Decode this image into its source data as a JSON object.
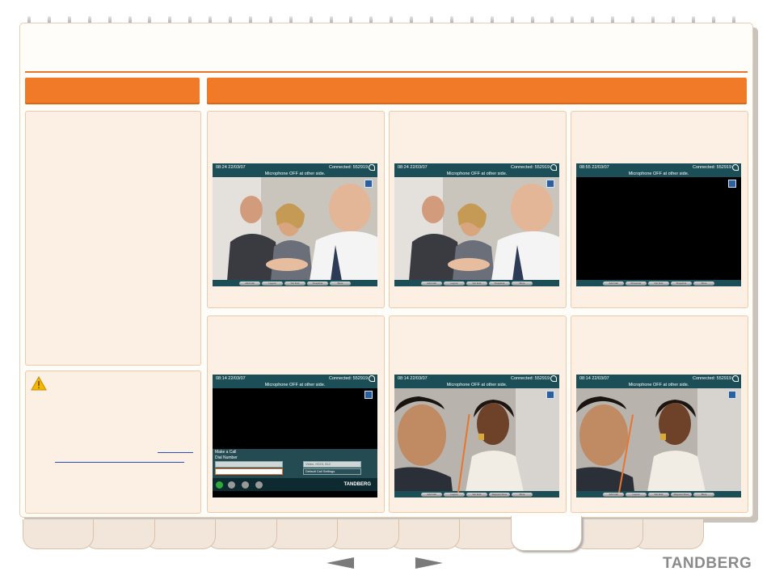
{
  "screens": {
    "top": [
      {
        "time": "08:24  22/03/07",
        "connected": "Connected: 552919",
        "message": "Microphone OFF at other side.",
        "buttons": [
          "Add Call",
          "Layout",
          "Far End",
          "Snapshot",
          "More"
        ]
      },
      {
        "time": "08:24  22/03/07",
        "connected": "Connected: 552919",
        "message": "Microphone OFF at other side.",
        "buttons": [
          "Add Call",
          "Layout",
          "Far End",
          "Snapshot",
          "More"
        ]
      },
      {
        "time": "08:55  22/03/07",
        "connected": "Connected: 552919",
        "message": "Microphone OFF at other side.",
        "buttons": [
          "Add Call",
          "Presenter",
          "Far End",
          "Snapshot",
          "More"
        ]
      }
    ],
    "bottom": [
      {
        "time": "08:14  22/03/07",
        "connected": "Connected: 552919",
        "message": "Microphone OFF at other side."
      },
      {
        "time": "08:14  22/03/07",
        "connected": "Connected: 552919",
        "message": "Microphone OFF at other side.",
        "buttons": [
          "Add Call",
          "Layout",
          "Far End",
          "Request Floor",
          "More"
        ]
      },
      {
        "time": "08:14  22/03/07",
        "connected": "Connected: 552919",
        "message": "Microphone OFF at other side.",
        "buttons": [
          "Add Call",
          "Layout",
          "Far End",
          "Request Floor",
          "More"
        ]
      }
    ]
  },
  "dial_menu": {
    "title": "Make a Call",
    "dial_number_label": "Dial Number",
    "protocol": "Video, H323, 512",
    "call_settings": "Default Call Settings",
    "brand": "TANDBERG"
  },
  "footer": {
    "logo": "TANDBERG",
    "tab_count": 11,
    "active_tab": 8
  },
  "colors": {
    "accent": "#f07a28",
    "panel": "#fcefe4",
    "screen_bar": "#1b4e57"
  }
}
